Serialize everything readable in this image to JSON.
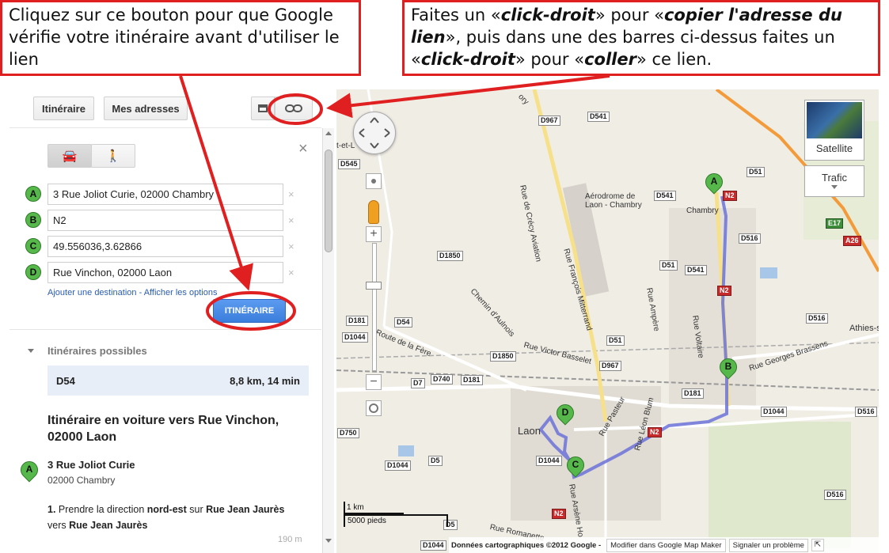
{
  "callout_left": {
    "text": "Cliquez sur ce bouton pour que Google vérifie votre itinéraire avant d'utiliser le lien"
  },
  "callout_right": {
    "p1": "Faites un «",
    "b1": "click-droit",
    "p2": "» pour «",
    "b2": "copier l'adresse du lien",
    "p3": "», puis dans une des barres ci-dessus faites un «",
    "b3": "click-droit",
    "p4": "» pour «",
    "b4": "coller",
    "p5": "» ce lien."
  },
  "toolbar": {
    "itineraire": "Itinéraire",
    "mes_adresses": "Mes adresses"
  },
  "close_glyph": "×",
  "waypoints": [
    {
      "letter": "A",
      "value": "3 Rue Joliot Curie, 02000 Chambry"
    },
    {
      "letter": "B",
      "value": "N2"
    },
    {
      "letter": "C",
      "value": "49.556036,3.62866"
    },
    {
      "letter": "D",
      "value": "Rue Vinchon, 02000 Laon"
    }
  ],
  "links": {
    "add_destination": "Ajouter une destination",
    "sep": " - ",
    "show_options": "Afficher les options"
  },
  "go_button": "ITINÉRAIRE",
  "routes_header": "Itinéraires possibles",
  "route": {
    "name": "D54",
    "summary": "8,8 km, 14 min"
  },
  "directions_title": "Itinéraire en voiture vers Rue Vinchon, 02000 Laon",
  "start": {
    "letter": "A",
    "street": "3 Rue Joliot Curie",
    "city": "02000 Chambry"
  },
  "step1": {
    "num": "1.",
    "t1": " Prendre la direction ",
    "b1": "nord-est",
    "t2": " sur ",
    "b2": "Rue Jean Jaurès",
    "t3": " vers ",
    "b3": "Rue Jean Jaurès",
    "dist": "190 m"
  },
  "map": {
    "satellite": "Satellite",
    "trafic": "Trafic",
    "scale_km": "1 km",
    "scale_ft": "5000 pieds",
    "footer_data": "Données cartographiques ©2012 Google -",
    "footer_edit": "Modifier dans Google Map Maker",
    "footer_report": "Signaler un problème",
    "places": {
      "chambry": "Chambry",
      "laon": "Laon",
      "athies": "Athies-s",
      "aerodrome": "Aérodrome de Laon - Chambry",
      "ruecrecy": "Rue de Crécy Aviation",
      "ruefm": "Rue François Mitterrand",
      "ruefere": "Route de la Fère",
      "chemin": "Chemin d'Aulnois",
      "victor": "Rue Victor Basselet",
      "ampere": "Rue Ampère",
      "voltaire": "Rue Voltaire",
      "brassens": "Rue Georges Brassens",
      "pasteur": "Rue Pasteur",
      "leonblum": "Rue Léon Blum",
      "arsene": "Rue Arsène Ho",
      "romanette": "Rue Romanette",
      "etl": "t-et-L",
      "ory": "ory"
    },
    "roads": [
      "D967",
      "D541",
      "D545",
      "D541",
      "D51",
      "N2",
      "E17",
      "A26",
      "D516",
      "D1850",
      "D51",
      "D541",
      "N2",
      "D181",
      "D54",
      "D1044",
      "D1850",
      "D516",
      "D51",
      "D967",
      "D181",
      "D7",
      "D740",
      "D181",
      "D1044",
      "D516",
      "D750",
      "D5",
      "D1044",
      "N2",
      "D5",
      "D1044",
      "D1044",
      "D516",
      "N2"
    ]
  }
}
